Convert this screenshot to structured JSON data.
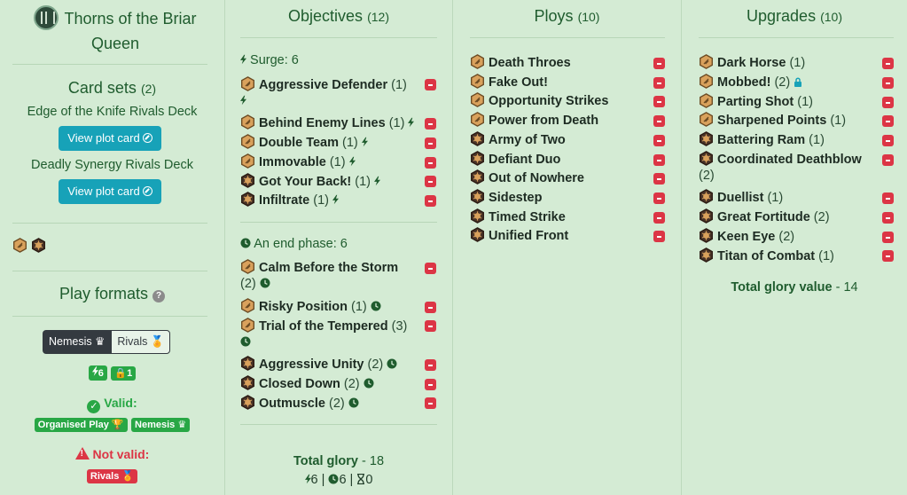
{
  "faction": {
    "name_line1": "Thorns of the Briar",
    "name_line2": "Queen"
  },
  "card_sets": {
    "title": "Card sets",
    "count": "(2)",
    "decks": [
      {
        "name": "Edge of the Knife Rivals Deck",
        "button": "View plot card"
      },
      {
        "name": "Deadly Synergy Rivals Deck",
        "button": "View plot card"
      }
    ]
  },
  "play_formats": {
    "title": "Play formats",
    "toggle": {
      "active": "Nemesis",
      "inactive": "Rivals"
    },
    "counts": {
      "surge": "6",
      "lock": "1"
    },
    "valid_label": "Valid:",
    "valid_formats": [
      "Organised Play",
      "Nemesis"
    ],
    "invalid_label": "Not valid:",
    "invalid_formats": [
      "Rivals"
    ]
  },
  "objectives": {
    "title": "Objectives",
    "count": "(12)",
    "surge_label": "Surge: 6",
    "end_label": "An end phase: 6",
    "surge_cards": [
      {
        "name": "Aggressive Defender",
        "count": "(1)"
      },
      {
        "name": "Behind Enemy Lines",
        "count": "(1)"
      },
      {
        "name": "Double Team",
        "count": "(1)"
      },
      {
        "name": "Immovable",
        "count": "(1)"
      },
      {
        "name": "Got Your Back!",
        "count": "(1)"
      },
      {
        "name": "Infiltrate",
        "count": "(1)"
      }
    ],
    "end_cards": [
      {
        "name": "Calm Before the Storm",
        "count": "(2)"
      },
      {
        "name": "Risky Position",
        "count": "(1)"
      },
      {
        "name": "Trial of the Tempered",
        "count": "(3)"
      },
      {
        "name": "Aggressive Unity",
        "count": "(2)"
      },
      {
        "name": "Closed Down",
        "count": "(2)"
      },
      {
        "name": "Outmuscle",
        "count": "(2)"
      }
    ],
    "total_label": "Total glory",
    "total_value": "- 18",
    "summary": {
      "surge": "6",
      "end": "6",
      "hourglass": "0"
    }
  },
  "ploys": {
    "title": "Ploys",
    "count": "(10)",
    "cards": [
      {
        "name": "Death Throes"
      },
      {
        "name": "Fake Out!"
      },
      {
        "name": "Opportunity Strikes"
      },
      {
        "name": "Power from Death"
      },
      {
        "name": "Army of Two"
      },
      {
        "name": "Defiant Duo"
      },
      {
        "name": "Out of Nowhere"
      },
      {
        "name": "Sidestep"
      },
      {
        "name": "Timed Strike"
      },
      {
        "name": "Unified Front"
      }
    ]
  },
  "upgrades": {
    "title": "Upgrades",
    "count": "(10)",
    "cards": [
      {
        "name": "Dark Horse",
        "count": "(1)"
      },
      {
        "name": "Mobbed!",
        "count": "(2)"
      },
      {
        "name": "Parting Shot",
        "count": "(1)"
      },
      {
        "name": "Sharpened Points",
        "count": "(1)"
      },
      {
        "name": "Battering Ram",
        "count": "(1)"
      },
      {
        "name": "Coordinated Deathblow",
        "count": "(2)"
      },
      {
        "name": "Duellist",
        "count": "(1)"
      },
      {
        "name": "Great Fortitude",
        "count": "(2)"
      },
      {
        "name": "Keen Eye",
        "count": "(2)"
      },
      {
        "name": "Titan of Combat",
        "count": "(1)"
      }
    ],
    "total_label": "Total glory value",
    "total_value": "- 14"
  },
  "colors": {
    "background": "#d4ebd4",
    "accent_green": "#1f5c2e",
    "button_teal": "#17a2b8",
    "remove_red": "#dc3545",
    "valid_green": "#28a745"
  }
}
